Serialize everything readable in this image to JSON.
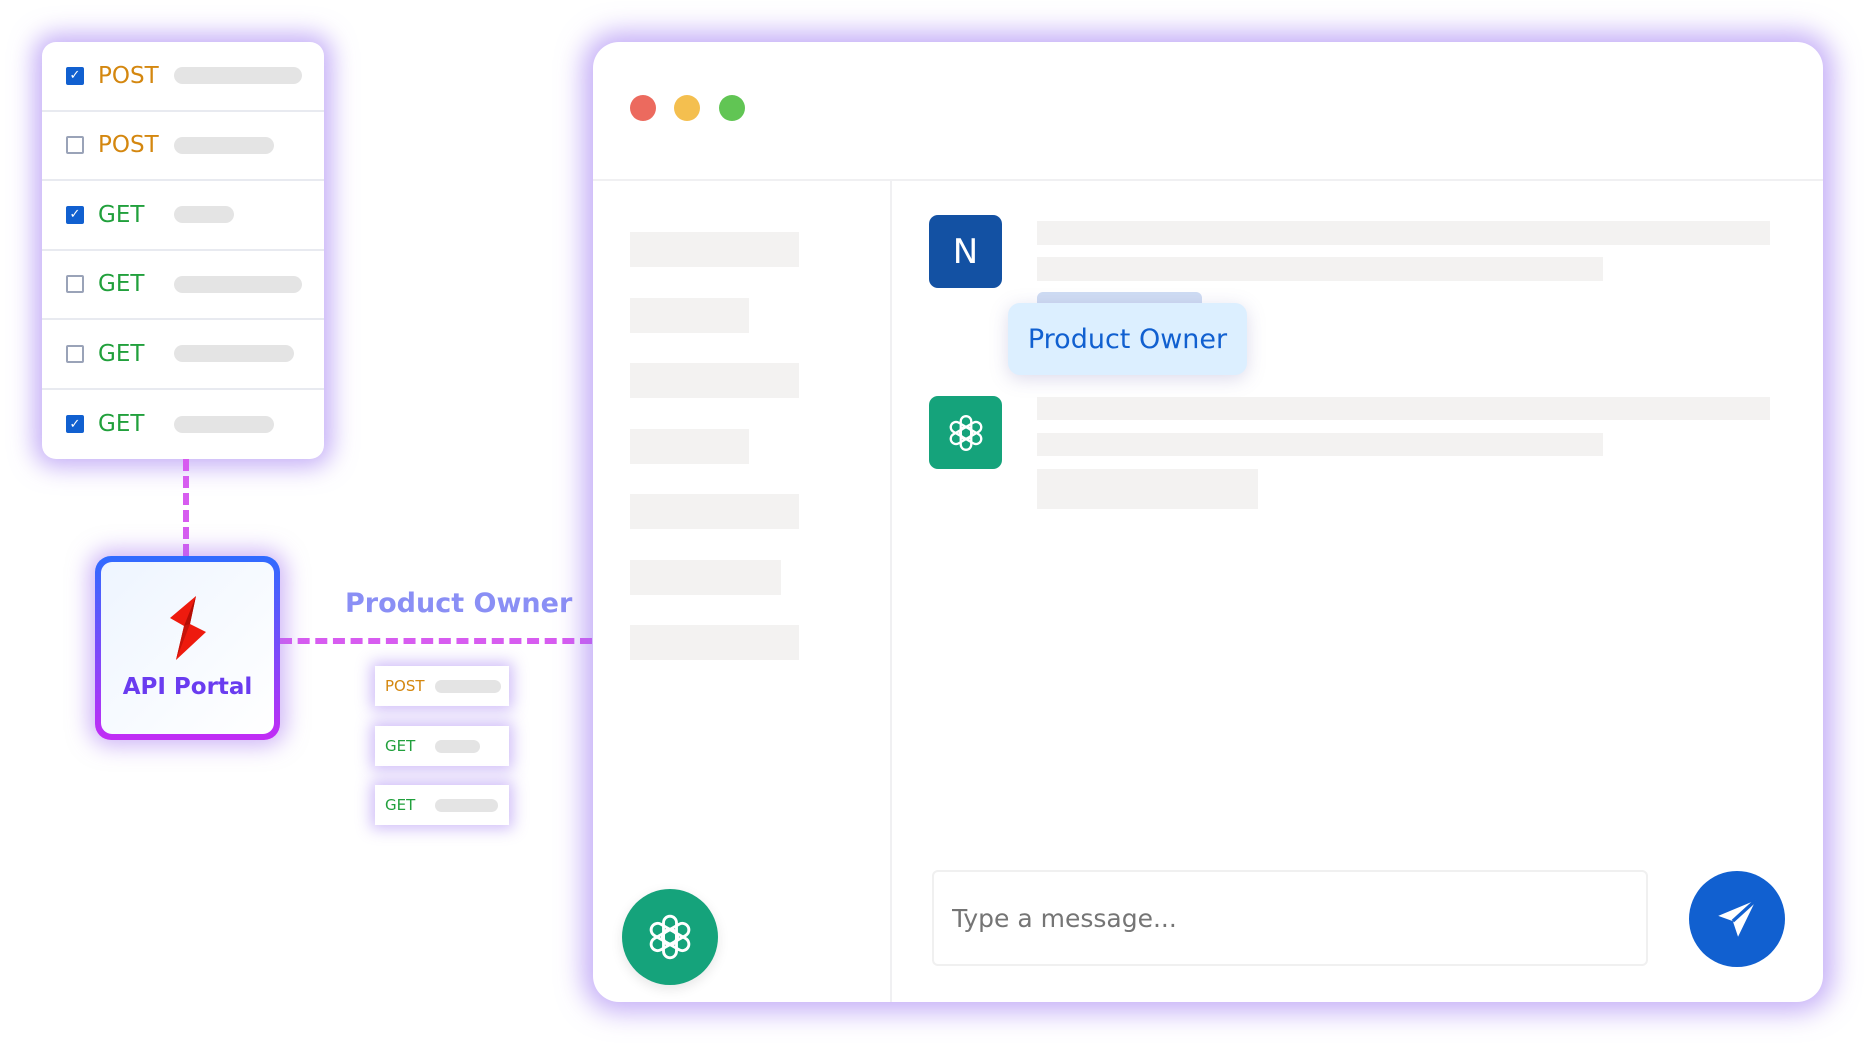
{
  "endpoint_list": [
    {
      "method": "POST",
      "checked": true
    },
    {
      "method": "POST",
      "checked": false
    },
    {
      "method": "GET",
      "checked": true
    },
    {
      "method": "GET",
      "checked": false
    },
    {
      "method": "GET",
      "checked": false
    },
    {
      "method": "GET",
      "checked": true
    }
  ],
  "portal": {
    "label": "API Portal",
    "icon": "lightning-bolt-icon"
  },
  "connector_label": "Product Owner",
  "mini_endpoints": [
    {
      "method": "POST"
    },
    {
      "method": "GET"
    },
    {
      "method": "GET"
    }
  ],
  "chat": {
    "user_avatar": "N",
    "role_badge": "Product Owner",
    "input_placeholder": "Type a message...",
    "send_icon": "paper-plane-icon",
    "assistant_icon": "openai-logo-icon"
  },
  "colors": {
    "post": "#d4870f",
    "get": "#21a03c",
    "checkbox": "#1160d0",
    "connector": "#d75cf0",
    "user_avatar": "#1351a3",
    "assistant_avatar": "#15a37b",
    "send_button": "#1160d0",
    "traffic_lights": [
      "#ec6a5e",
      "#f4bf4f",
      "#61c554"
    ]
  }
}
